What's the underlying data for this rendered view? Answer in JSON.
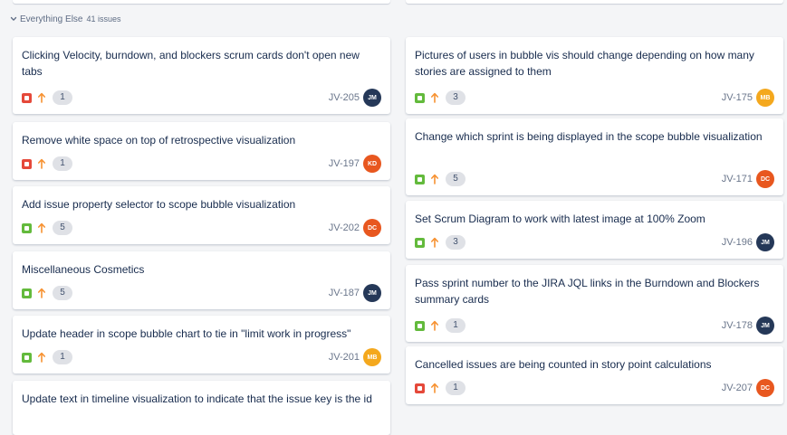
{
  "swimlane": {
    "title": "Everything Else",
    "count": "41 issues"
  },
  "colors": {
    "bug": "#e5493a",
    "story": "#63ba3c",
    "priority": "#f79232"
  },
  "columns": [
    {
      "cards": [
        {
          "summary": "Clicking Velocity, burndown, and blockers scrum cards don't open new tabs",
          "type": "bug",
          "type_icon": "bug-icon",
          "priority_icon": "priority-high-icon",
          "points": "1",
          "key": "JV-205",
          "assignee": "JM",
          "avatar_color": "#253858"
        },
        {
          "summary": "Remove white space on top of retrospective visualization",
          "type": "bug",
          "type_icon": "bug-icon",
          "priority_icon": "priority-high-icon",
          "points": "1",
          "key": "JV-197",
          "assignee": "KD",
          "avatar_color": "#e8571f"
        },
        {
          "summary": "Add issue property selector to scope bubble visualization",
          "type": "story",
          "type_icon": "story-icon",
          "priority_icon": "priority-high-icon",
          "points": "5",
          "key": "JV-202",
          "assignee": "DC",
          "avatar_color": "#e8571f"
        },
        {
          "summary": "Miscellaneous Cosmetics",
          "type": "story",
          "type_icon": "story-icon",
          "priority_icon": "priority-high-icon",
          "points": "5",
          "key": "JV-187",
          "assignee": "JM",
          "avatar_color": "#253858"
        },
        {
          "summary": "Update header in scope bubble chart to tie in \"limit work in progress\"",
          "type": "story",
          "type_icon": "story-icon",
          "priority_icon": "priority-high-icon",
          "points": "1",
          "key": "JV-201",
          "assignee": "MB",
          "avatar_color": "#f4a81d"
        },
        {
          "summary": "Update text in timeline visualization to indicate that the issue key is the id",
          "type": "story",
          "type_icon": "story-icon",
          "priority_icon": "priority-high-icon",
          "points": "",
          "key": "",
          "assignee": "",
          "avatar_color": "#ffffff"
        }
      ]
    },
    {
      "cards": [
        {
          "summary": "Pictures of users in bubble vis should change depending on how many stories are assigned to them",
          "type": "story",
          "type_icon": "story-icon",
          "priority_icon": "priority-high-icon",
          "points": "3",
          "key": "JV-175",
          "assignee": "MB",
          "avatar_color": "#f4a81d"
        },
        {
          "summary": "Change which sprint is being displayed in the scope bubble visualization",
          "type": "story",
          "type_icon": "story-icon",
          "priority_icon": "priority-high-icon",
          "points": "5",
          "key": "JV-171",
          "assignee": "DC",
          "avatar_color": "#e8571f"
        },
        {
          "summary": "Set Scrum Diagram to work with latest image at 100% Zoom",
          "type": "story",
          "type_icon": "story-icon",
          "priority_icon": "priority-high-icon",
          "points": "3",
          "key": "JV-196",
          "assignee": "JM",
          "avatar_color": "#253858"
        },
        {
          "summary": "Pass sprint number to the JIRA JQL links in the Burndown and Blockers summary cards",
          "type": "story",
          "type_icon": "story-icon",
          "priority_icon": "priority-high-icon",
          "points": "1",
          "key": "JV-178",
          "assignee": "JM",
          "avatar_color": "#253858"
        },
        {
          "summary": "Cancelled issues are being counted in story point calculations",
          "type": "bug",
          "type_icon": "bug-icon",
          "priority_icon": "priority-high-icon",
          "points": "1",
          "key": "JV-207",
          "assignee": "DC",
          "avatar_color": "#e8571f"
        }
      ]
    }
  ]
}
